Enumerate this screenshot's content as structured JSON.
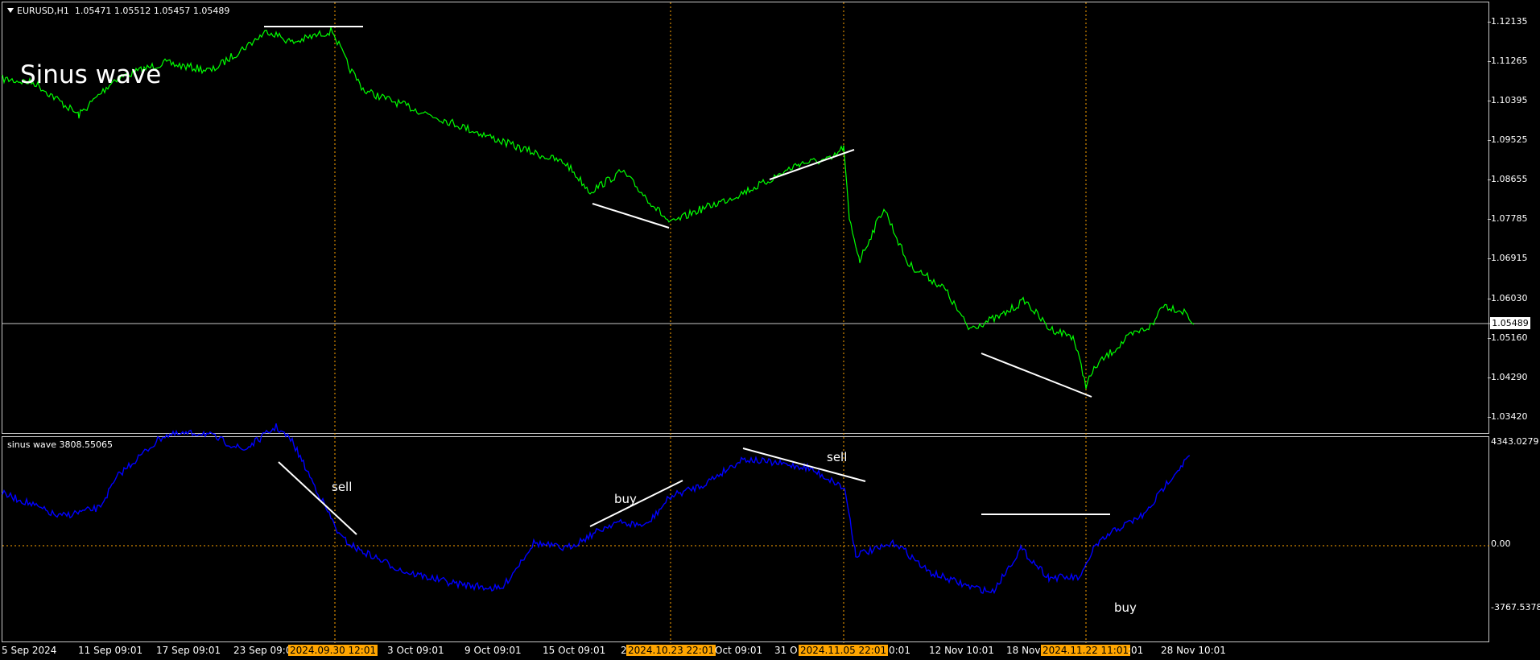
{
  "chart": {
    "symbol_header": "EURUSD,H1  1.05471 1.05512 1.05457 1.05489",
    "title_overlay": "Sinus wave",
    "current_price": "1.05489",
    "price_ticks": [
      "1.12135",
      "1.11265",
      "1.10395",
      "1.09525",
      "1.08655",
      "1.07785",
      "1.06915",
      "1.06030",
      "1.05160",
      "1.04290",
      "1.03420"
    ],
    "colors": {
      "price_line": "#00ff00",
      "indicator_line": "#0000ff",
      "marker": "#ffa500",
      "background": "#000000"
    }
  },
  "indicator": {
    "header": "sinus wave 3808.55065",
    "ticks": [
      "4343.0279",
      "0.00",
      "-3767.5378"
    ]
  },
  "annotations": {
    "sell_1": "sell",
    "buy_1": "buy",
    "sell_2": "sell",
    "buy_2": "buy"
  },
  "time_axis": {
    "labels": [
      "5 Sep 2024",
      "11 Sep 09:01",
      "17 Sep 09:01",
      "23 Sep 09:0",
      "3 Oct 09:01",
      "9 Oct 09:01",
      "15 Oct 09:01",
      "2",
      "Oct 09:01",
      "31 O",
      "0:01",
      "12 Nov 10:01",
      "18 Nov",
      ":01",
      "28 Nov 10:01"
    ],
    "highlights": [
      "2024.09.30 12:01",
      "2024.10.23 22:01",
      "2024.11.05 22:01",
      "2024.11.22 11:01"
    ]
  }
}
